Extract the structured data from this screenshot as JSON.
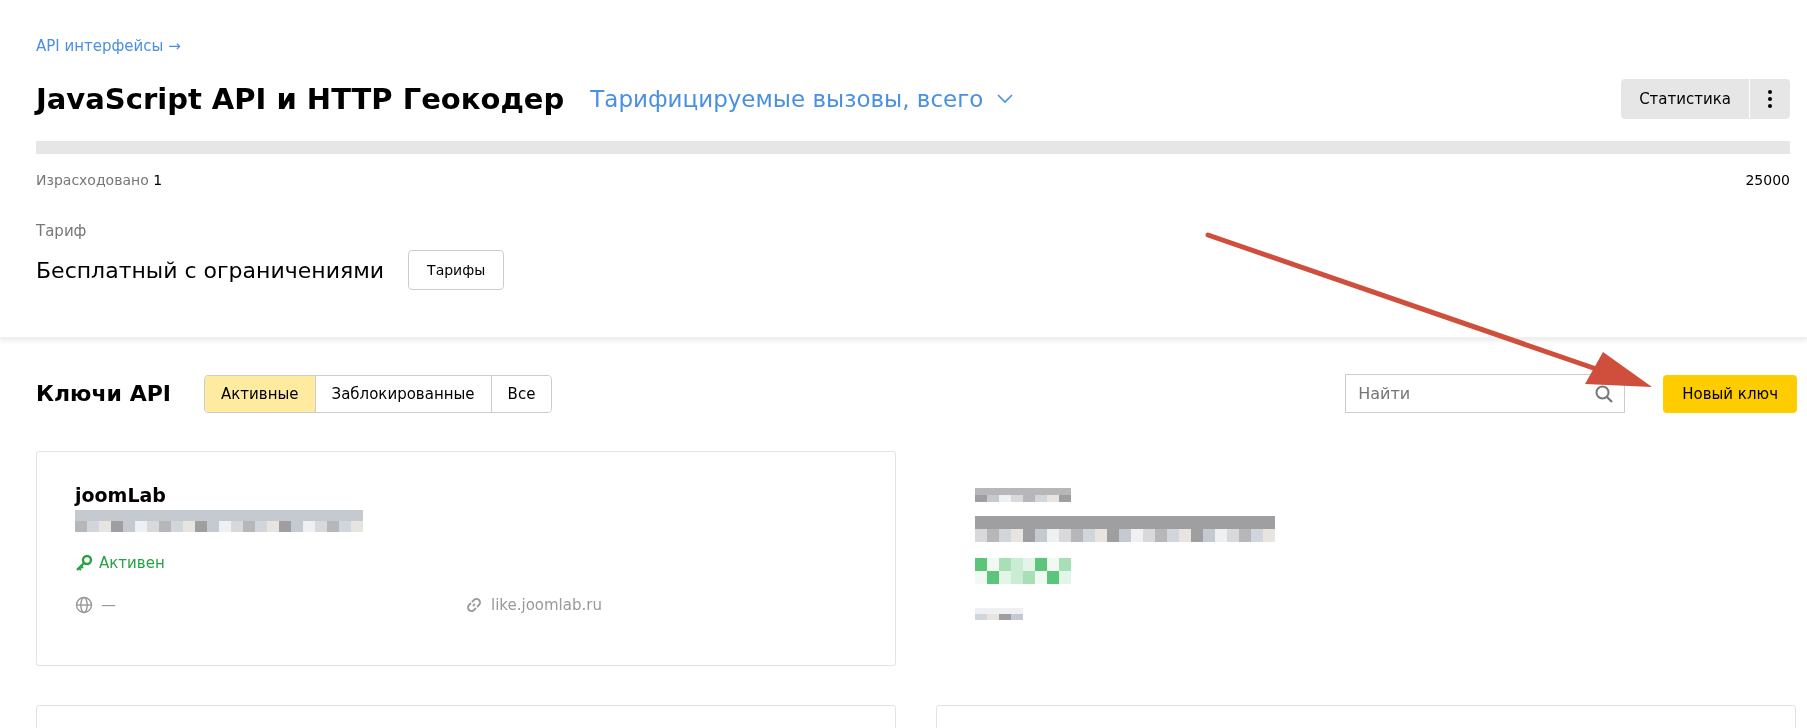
{
  "breadcrumb": "API интерфейсы →",
  "title": "JavaScript API и HTTP Геокодер",
  "metric_dropdown": "Тарифицируемые вызовы, всего",
  "stats_button": "Статистика",
  "usage": {
    "label": "Израсходовано",
    "used": "1",
    "limit": "25000",
    "level": 4e-05
  },
  "tariff": {
    "label": "Тариф",
    "name": "Бесплатный с ограничениями",
    "button": "Тарифы"
  },
  "keys": {
    "title": "Ключи API",
    "filters": [
      {
        "label": "Активные",
        "selected": true
      },
      {
        "label": "Заблокированные",
        "selected": false
      },
      {
        "label": "Все",
        "selected": false
      }
    ],
    "search": {
      "placeholder": "Найти"
    },
    "new_key_button": "Новый ключ",
    "cards": [
      {
        "kind": "visible",
        "name": "joomLab",
        "status": "Активен",
        "restriction": "—",
        "site": "like.joomlab.ru"
      },
      {
        "kind": "redacted"
      },
      {
        "kind": "empty"
      },
      {
        "kind": "empty"
      }
    ]
  }
}
